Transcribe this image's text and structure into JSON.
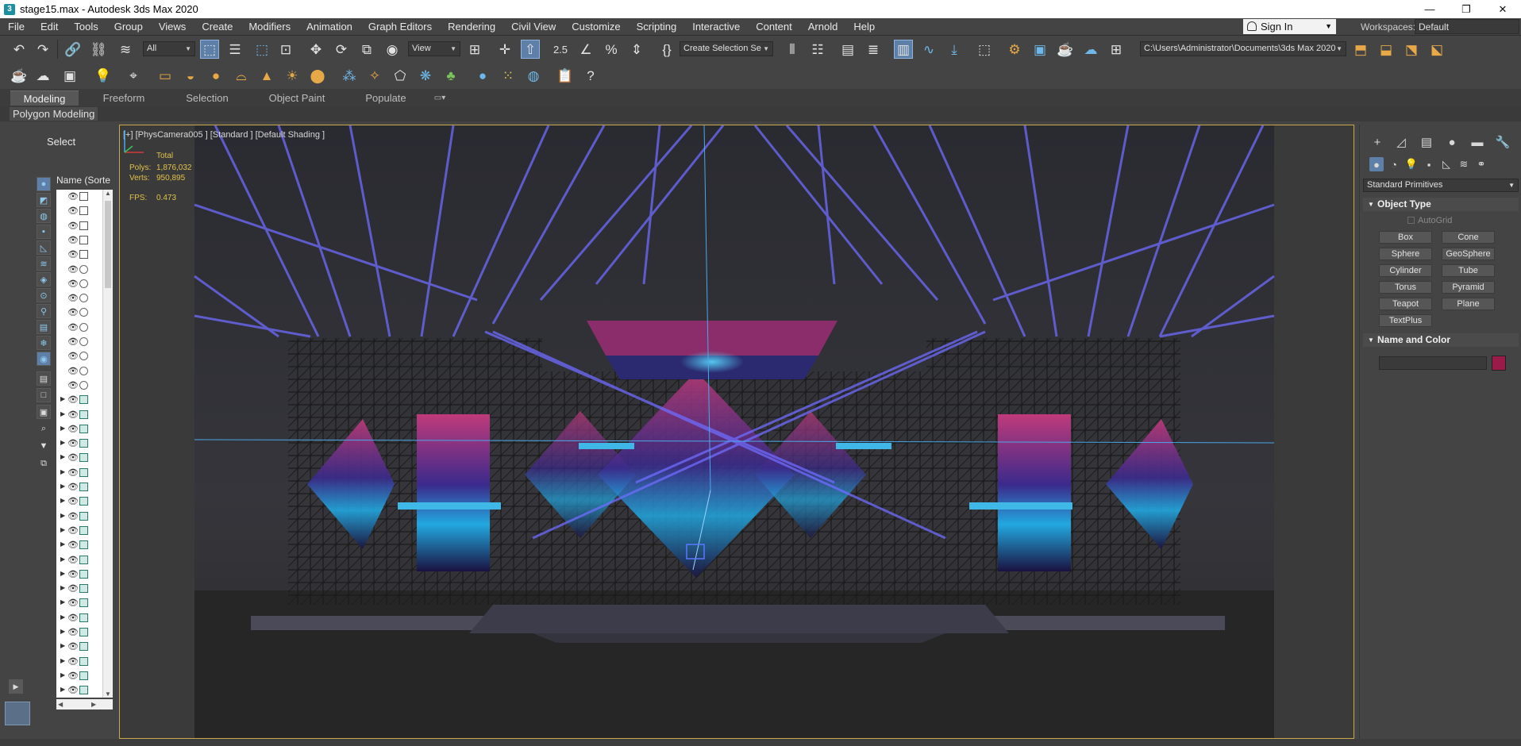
{
  "window": {
    "title": "stage15.max - Autodesk 3ds Max 2020",
    "app_icon_glyph": "3",
    "controls": [
      "—",
      "❐",
      "✕"
    ]
  },
  "menubar": {
    "items": [
      "File",
      "Edit",
      "Tools",
      "Group",
      "Views",
      "Create",
      "Modifiers",
      "Animation",
      "Graph Editors",
      "Rendering",
      "Civil View",
      "Customize",
      "Scripting",
      "Interactive",
      "Content",
      "Arnold",
      "Help"
    ],
    "sign_in": "Sign In",
    "workspaces_label": "Workspaces:",
    "workspace_value": "Default"
  },
  "toolbar": {
    "selection_filter": "All",
    "ref_coord": "View",
    "selection_set": "Create Selection Se",
    "project_path": "C:\\Users\\Administrator\\Documents\\3ds Max 2020",
    "snap_label": "2.5"
  },
  "ribbon": {
    "tabs": [
      "Modeling",
      "Freeform",
      "Selection",
      "Object Paint",
      "Populate"
    ],
    "active_tab": "Modeling",
    "sub_label": "Polygon Modeling"
  },
  "explorer": {
    "select_label": "Select",
    "column_header": "Name (Sorte"
  },
  "viewport": {
    "label": "[+] [PhysCamera005 ] [Standard ] [Default Shading ]",
    "stats_total": "Total",
    "stats_polys_label": "Polys:",
    "stats_polys": "1,876,032",
    "stats_verts_label": "Verts:",
    "stats_verts": "950,895",
    "fps_label": "FPS:",
    "fps": "0.473"
  },
  "command_panel": {
    "category": "Standard Primitives",
    "object_type_header": "Object Type",
    "autogrid": "AutoGrid",
    "primitives": [
      "Box",
      "Cone",
      "Sphere",
      "GeoSphere",
      "Cylinder",
      "Tube",
      "Torus",
      "Pyramid",
      "Teapot",
      "Plane",
      "TextPlus"
    ],
    "name_color_header": "Name and Color",
    "object_color": "#9b1b48"
  },
  "colors": {
    "ui_bg": "#444444",
    "viewport_bg": "#2c2c2c",
    "active_blue": "#5e7fa8",
    "viewport_border": "#c9a84a",
    "stats_yellow": "#e2c24a",
    "laser_blue": "#6f6cff"
  }
}
